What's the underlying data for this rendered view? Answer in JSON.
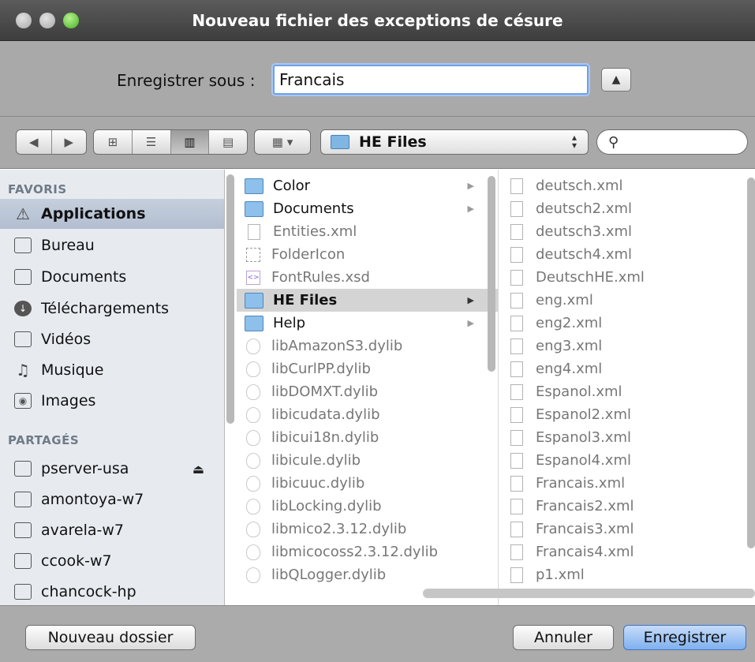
{
  "window": {
    "title": "Nouveau fichier des exceptions de césure"
  },
  "save": {
    "label": "Enregistrer sous :",
    "filename": "Francais"
  },
  "toolbar": {
    "back_icon": "chevron-left-icon",
    "forward_icon": "chevron-right-icon",
    "view_modes": [
      "icon-view-icon",
      "list-view-icon",
      "column-view-icon",
      "coverflow-view-icon"
    ],
    "selected_view": "column-view-icon",
    "arrange_icon": "arrange-icon",
    "location": "HE Files"
  },
  "sidebar": {
    "favorites_header": "FAVORIS",
    "favorites": [
      {
        "label": "Applications",
        "icon": "applications-icon",
        "selected": true
      },
      {
        "label": "Bureau",
        "icon": "desktop-icon"
      },
      {
        "label": "Documents",
        "icon": "documents-icon"
      },
      {
        "label": "Téléchargements",
        "icon": "downloads-icon"
      },
      {
        "label": "Vidéos",
        "icon": "movies-icon"
      },
      {
        "label": "Musique",
        "icon": "music-icon"
      },
      {
        "label": "Images",
        "icon": "camera-icon"
      }
    ],
    "shared_header": "PARTAGÉS",
    "shared": [
      {
        "label": "pserver-usa",
        "icon": "computer-icon",
        "eject": true
      },
      {
        "label": "amontoya-w7",
        "icon": "computer-icon"
      },
      {
        "label": "avarela-w7",
        "icon": "computer-icon"
      },
      {
        "label": "ccook-w7",
        "icon": "computer-icon"
      },
      {
        "label": "chancock-hp",
        "icon": "computer-icon"
      }
    ]
  },
  "column1": [
    {
      "name": "Color",
      "type": "folder"
    },
    {
      "name": "Documents",
      "type": "folder"
    },
    {
      "name": "Entities.xml",
      "type": "doc"
    },
    {
      "name": "FolderIcon",
      "type": "img"
    },
    {
      "name": "FontRules.xsd",
      "type": "xsd"
    },
    {
      "name": "HE Files",
      "type": "folder",
      "selected": true
    },
    {
      "name": "Help",
      "type": "folder"
    },
    {
      "name": "libAmazonS3.dylib",
      "type": "lib"
    },
    {
      "name": "libCurlPP.dylib",
      "type": "lib"
    },
    {
      "name": "libDOMXT.dylib",
      "type": "lib"
    },
    {
      "name": "libicudata.dylib",
      "type": "lib"
    },
    {
      "name": "libicui18n.dylib",
      "type": "lib"
    },
    {
      "name": "libicule.dylib",
      "type": "lib"
    },
    {
      "name": "libicuuc.dylib",
      "type": "lib"
    },
    {
      "name": "libLocking.dylib",
      "type": "lib"
    },
    {
      "name": "libmico2.3.12.dylib",
      "type": "lib"
    },
    {
      "name": "libmicocoss2.3.12.dylib",
      "type": "lib"
    },
    {
      "name": "libQLogger.dylib",
      "type": "lib"
    }
  ],
  "column2": [
    "deutsch.xml",
    "deutsch2.xml",
    "deutsch3.xml",
    "deutsch4.xml",
    "DeutschHE.xml",
    "eng.xml",
    "eng2.xml",
    "eng3.xml",
    "eng4.xml",
    "Espanol.xml",
    "Espanol2.xml",
    "Espanol3.xml",
    "Espanol4.xml",
    "Francais.xml",
    "Francais2.xml",
    "Francais3.xml",
    "Francais4.xml",
    "p1.xml"
  ],
  "buttons": {
    "new_folder": "Nouveau dossier",
    "cancel": "Annuler",
    "save": "Enregistrer"
  }
}
